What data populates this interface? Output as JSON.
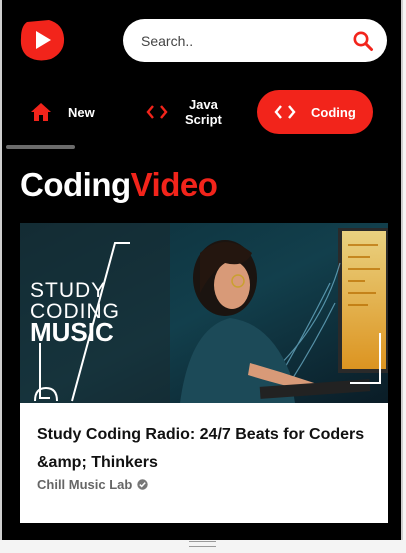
{
  "search": {
    "placeholder": "Search.."
  },
  "tabs": [
    {
      "label": "New",
      "icon": "home-icon",
      "active": false
    },
    {
      "label_line1": "Java",
      "label_line2": "Script",
      "icon": "code-icon",
      "active": false
    },
    {
      "label": "Coding",
      "icon": "code-icon",
      "active": true
    }
  ],
  "heading": {
    "part1": "Coding",
    "part2": "Video"
  },
  "video": {
    "thumbnail_text": [
      "STUDY",
      "CODING",
      "MUSIC"
    ],
    "title": "Study Coding Radio: 24/7 Beats for Coders &amp; Thinkers",
    "channel": "Chill Music Lab",
    "verified": true
  },
  "colors": {
    "accent": "#f2241b",
    "background": "#000000",
    "card": "#ffffff"
  }
}
